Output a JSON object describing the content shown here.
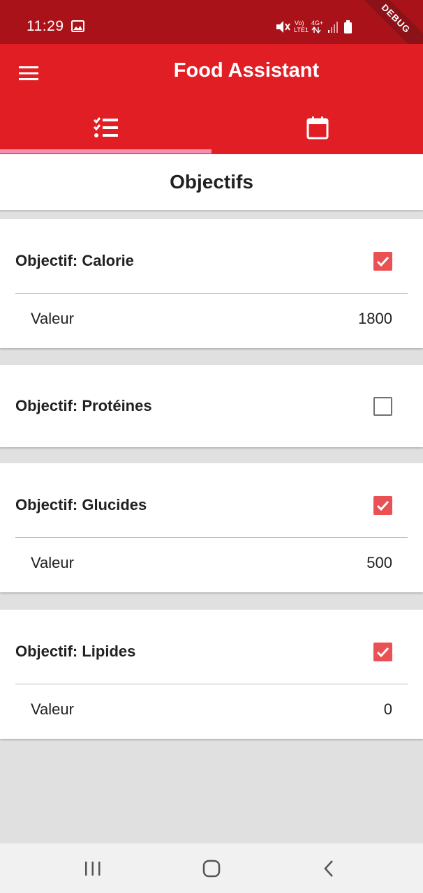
{
  "status_bar": {
    "time": "11:29",
    "debug_label": "DEBUG"
  },
  "app_bar": {
    "title": "Food Assistant",
    "menu_icon": "menu-icon",
    "tabs": [
      {
        "icon": "checklist-icon",
        "selected": true
      },
      {
        "icon": "calendar-icon",
        "selected": false
      }
    ],
    "colors": {
      "status": "#aa1219",
      "app_bar": "#e21e25",
      "indicator": "#f48fb1",
      "checkbox": "#ea5155"
    }
  },
  "section": {
    "title": "Objectifs"
  },
  "goals": [
    {
      "title": "Objectif: Calorie",
      "checked": true,
      "value_label": "Valeur",
      "value": "1800"
    },
    {
      "title": "Objectif: Protéines",
      "checked": false
    },
    {
      "title": "Objectif: Glucides",
      "checked": true,
      "value_label": "Valeur",
      "value": "500"
    },
    {
      "title": "Objectif: Lipides",
      "checked": true,
      "value_label": "Valeur",
      "value": "0"
    }
  ],
  "nav_bar": {
    "icons": [
      "recents-icon",
      "home-icon",
      "back-icon"
    ]
  }
}
